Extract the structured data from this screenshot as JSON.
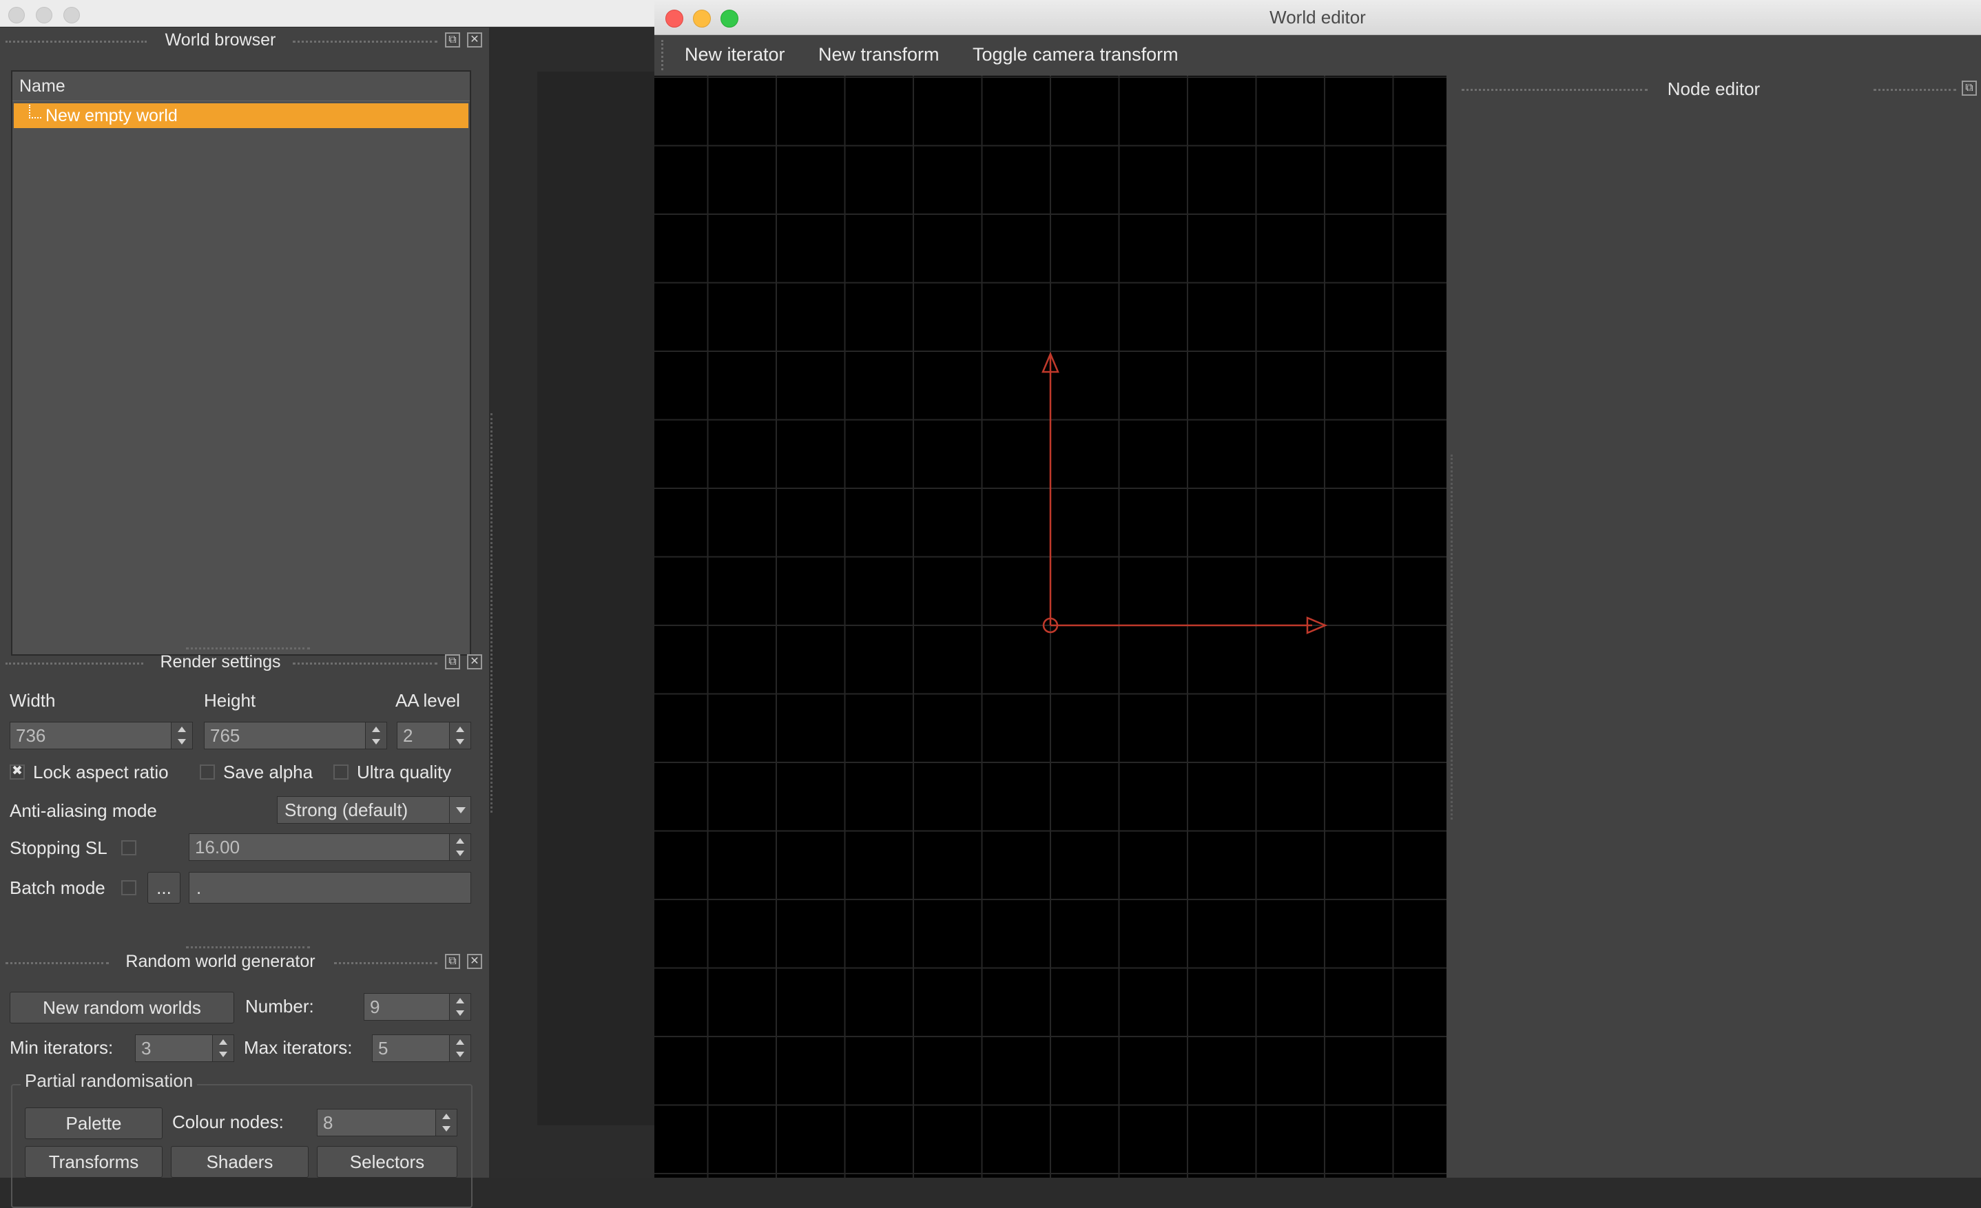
{
  "world_browser": {
    "title": "World browser",
    "column_header": "Name",
    "items": [
      "New empty world"
    ]
  },
  "render_settings": {
    "title": "Render settings",
    "width_label": "Width",
    "height_label": "Height",
    "aa_label": "AA level",
    "width_value": "736",
    "height_value": "765",
    "aa_value": "2",
    "lock_aspect_label": "Lock aspect ratio",
    "lock_aspect_checked": true,
    "save_alpha_label": "Save alpha",
    "ultra_quality_label": "Ultra quality",
    "aa_mode_label": "Anti-aliasing mode",
    "aa_mode_value": "Strong (default)",
    "stopping_sl_label": "Stopping SL",
    "stopping_sl_value": "16.00",
    "batch_mode_label": "Batch mode",
    "browse_label": "...",
    "batch_path_value": "."
  },
  "random_world_generator": {
    "title": "Random world generator",
    "new_random_worlds_label": "New random worlds",
    "number_label": "Number:",
    "number_value": "9",
    "min_iterators_label": "Min iterators:",
    "min_iterators_value": "3",
    "max_iterators_label": "Max iterators:",
    "max_iterators_value": "5",
    "partial_randomisation_label": "Partial randomisation",
    "palette_label": "Palette",
    "colour_nodes_label": "Colour nodes:",
    "colour_nodes_value": "8",
    "transforms_label": "Transforms",
    "shaders_label": "Shaders",
    "selectors_label": "Selectors"
  },
  "world_editor": {
    "title": "World editor",
    "toolbar": {
      "new_iterator": "New iterator",
      "new_transform": "New transform",
      "toggle_camera": "Toggle camera transform"
    },
    "node_editor_title": "Node editor"
  },
  "colors": {
    "selection": "#f2a12b",
    "gizmo": "#c0392b",
    "grid": "#262626"
  }
}
